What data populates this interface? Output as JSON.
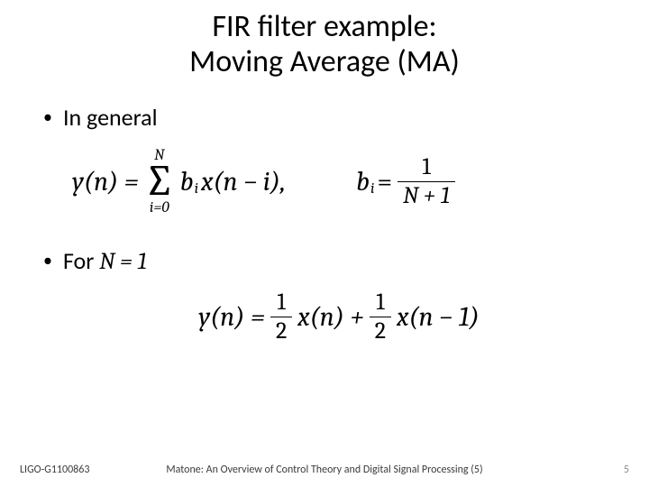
{
  "title_line1": "FIR filter example:",
  "title_line2": "Moving Average (MA)",
  "bullet1": "In general",
  "eq1": {
    "lhs": "y(n) = ",
    "sum_upper": "N",
    "sum_lower": "i=0",
    "term_b": "b",
    "term_b_sub": "i",
    "term_xn": " x(n − i),",
    "rhs_b": "b",
    "rhs_b_sub": "i",
    "rhs_eq": " = ",
    "frac_num": "1",
    "frac_den": "N + 1"
  },
  "bullet2_prefix": "For ",
  "bullet2_math": "N = 1",
  "eq2": {
    "lhs": "y(n) = ",
    "half_num": "1",
    "half_den": "2",
    "xn": " x(n) + ",
    "xn1": " x(n − 1)"
  },
  "footer_left": "LIGO-G1100863",
  "footer_center": "Matone: An Overview of Control Theory and Digital Signal Processing (5)",
  "footer_right": "5"
}
